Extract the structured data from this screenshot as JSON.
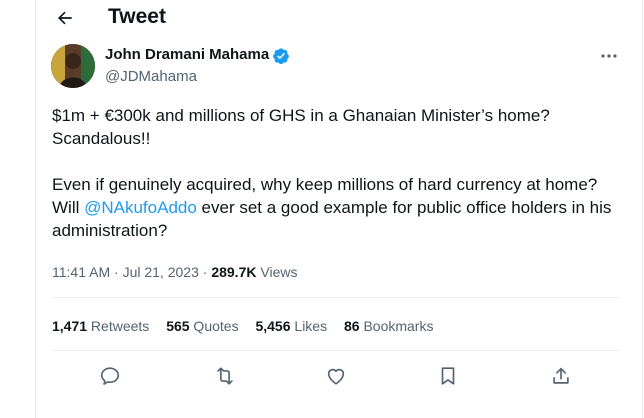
{
  "header": {
    "title": "Tweet",
    "back_icon": "arrow-left-icon"
  },
  "author": {
    "name": "John Dramani Mahama",
    "handle": "@JDMahama",
    "verified_icon": "verified-badge-icon",
    "verified_color": "#1d9bf0"
  },
  "tweet": {
    "line1": "$1m + €300k and millions of GHS in a Ghanaian Minister’s home? Scandalous!!",
    "line2_before": "Even if genuinely acquired, why keep millions of hard currency at home? Will ",
    "mention": "@NAkufoAddo",
    "line2_after": " ever set a good example for public office holders in his administration?"
  },
  "meta": {
    "time": "11:41 AM",
    "sep1": " · ",
    "date": "Jul 21, 2023",
    "sep2": " · ",
    "views_count": "289.7K",
    "views_label": " Views"
  },
  "stats": [
    {
      "count": "1,471",
      "label": " Retweets"
    },
    {
      "count": "565",
      "label": " Quotes"
    },
    {
      "count": "5,456",
      "label": " Likes"
    },
    {
      "count": "86",
      "label": " Bookmarks"
    }
  ],
  "actions": [
    "reply-icon",
    "retweet-icon",
    "like-icon",
    "bookmark-icon",
    "share-icon"
  ],
  "colors": {
    "accent": "#1d9bf0",
    "secondary_text": "#536471",
    "border": "#e6ecf0"
  }
}
